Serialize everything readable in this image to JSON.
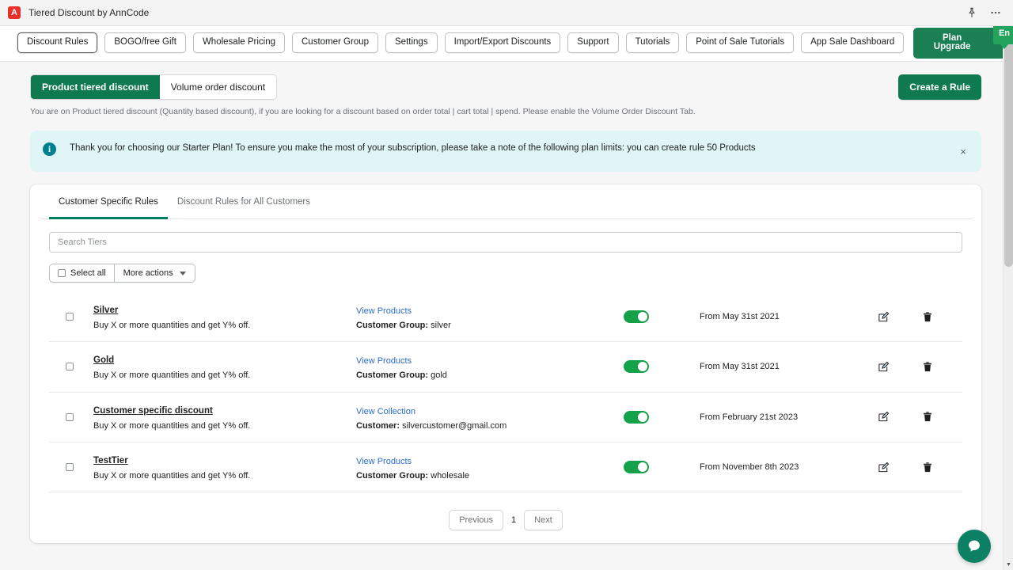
{
  "window": {
    "title": "Tiered Discount by AnnCode",
    "app_icon": "A",
    "pin_icon": "pin-icon",
    "more_icon": "more-horizontal-icon"
  },
  "navbar": {
    "items": [
      {
        "label": "Discount Rules",
        "active": true
      },
      {
        "label": "BOGO/free Gift",
        "active": false
      },
      {
        "label": "Wholesale Pricing",
        "active": false
      },
      {
        "label": "Customer Group",
        "active": false
      },
      {
        "label": "Settings",
        "active": false
      },
      {
        "label": "Import/Export Discounts",
        "active": false
      },
      {
        "label": "Support",
        "active": false
      },
      {
        "label": "Tutorials",
        "active": false
      },
      {
        "label": "Point of Sale Tutorials",
        "active": false
      },
      {
        "label": "App Sale Dashboard",
        "active": false
      }
    ],
    "plan_upgrade": "Plan Upgrade",
    "plan_badge": "En"
  },
  "subtabs": {
    "product_tiered": "Product tiered discount",
    "volume_order": "Volume order discount",
    "create_rule": "Create a Rule",
    "helper": "You are on Product tiered discount (Quantity based discount), if you are looking for a discount based on order total | cart total | spend. Please enable the Volume Order Discount Tab."
  },
  "banner": {
    "icon": "info-icon",
    "glyph": "i",
    "text": "Thank you for choosing our Starter Plan! To ensure you make the most of your subscription, please take a note of the following plan limits: you can create rule 50 Products",
    "close": "×",
    "bg_color": "#e0f5f5",
    "icon_color": "#00808f"
  },
  "card": {
    "tabs": [
      {
        "label": "Customer Specific Rules",
        "active": true
      },
      {
        "label": "Discount Rules for All Customers",
        "active": false
      }
    ],
    "search": {
      "value": "",
      "placeholder": "Search Tiers"
    },
    "select_all": "Select all",
    "more_actions": "More actions",
    "rows": [
      {
        "name": "Silver",
        "description": "Buy X or more quantities and get Y% off.",
        "link": "View Products",
        "meta_label": "Customer Group:",
        "meta_value": "silver",
        "enabled": true,
        "date": "From May 31st 2021"
      },
      {
        "name": "Gold",
        "description": "Buy X or more quantities and get Y% off.",
        "link": "View Products",
        "meta_label": "Customer Group:",
        "meta_value": "gold",
        "enabled": true,
        "date": "From May 31st 2021"
      },
      {
        "name": "Customer specific discount",
        "description": "Buy X or more quantities and get Y% off.",
        "link": "View Collection",
        "meta_label": "Customer:",
        "meta_value": "silvercustomer@gmail.com",
        "enabled": true,
        "date": "From February 21st 2023"
      },
      {
        "name": "TestTier",
        "description": "Buy X or more quantities and get Y% off.",
        "link": "View Products",
        "meta_label": "Customer Group:",
        "meta_value": "wholesale",
        "enabled": true,
        "date": "From November 8th 2023"
      }
    ],
    "pagination": {
      "previous": "Previous",
      "page": "1",
      "next": "Next"
    }
  },
  "chat": {
    "icon": "chat-bubble-icon",
    "color": "#0b8062"
  },
  "colors": {
    "brand_green": "#0f7a4f",
    "toggle_green": "#15a04a",
    "link_blue": "#2c6ecb",
    "badge_green": "#23a35b"
  }
}
